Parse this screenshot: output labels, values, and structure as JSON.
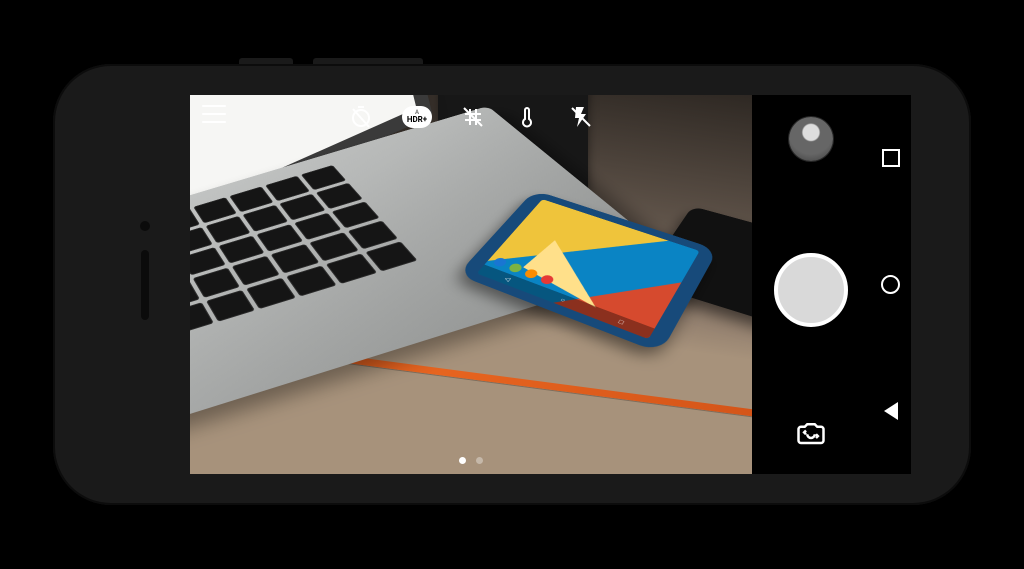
{
  "app": {
    "name": "Camera"
  },
  "topbar": {
    "menu_icon": "menu-icon",
    "items": [
      {
        "id": "timer",
        "icon": "timer-off-icon"
      },
      {
        "id": "hdr",
        "icon": "hdr-auto-icon",
        "label": "HDR+",
        "sub": "A"
      },
      {
        "id": "grid",
        "icon": "grid-off-icon"
      },
      {
        "id": "whitebalance",
        "icon": "thermometer-icon"
      },
      {
        "id": "flash",
        "icon": "flash-off-icon"
      }
    ]
  },
  "mode_dots": {
    "count": 2,
    "active_index": 0
  },
  "controls": {
    "gallery_thumbnail": "last-photo-thumbnail",
    "shutter": "shutter-button",
    "switch_camera": "switch-camera-icon"
  },
  "android_nav": {
    "recents": "recents-button",
    "home": "home-button",
    "back": "back-button"
  },
  "viewfinder_scene": {
    "description": "Desk with MacBook keyboard on the left, a blue Android phone showing a colorful Material wallpaper, a black tablet, a dark leather folio, all on a tan wooden desk with an orange edge stripe."
  },
  "colors": {
    "shutter": "#d9d9d9",
    "desk": "#a7927b",
    "orange_stripe": "#e7641f",
    "phone_case": "#174a7a"
  }
}
